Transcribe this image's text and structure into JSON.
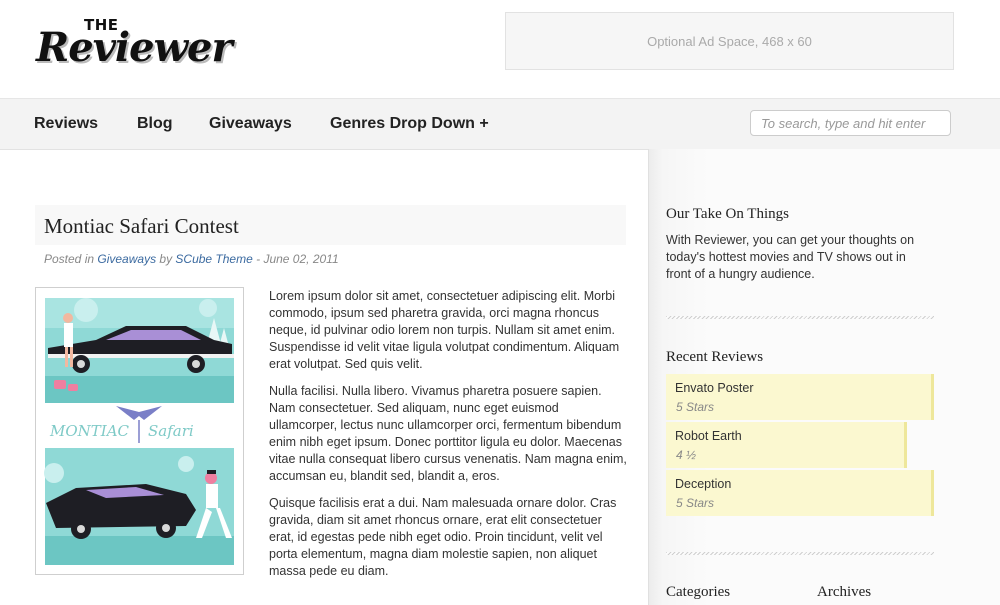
{
  "header": {
    "logo_small": "THE",
    "logo_main": "Reviewer",
    "ad_text": "Optional Ad Space, 468 x 60"
  },
  "nav": {
    "items": [
      {
        "label": "Reviews"
      },
      {
        "label": "Blog"
      },
      {
        "label": "Giveaways"
      },
      {
        "label": "Genres Drop Down +"
      }
    ],
    "search_placeholder": "To search, type and hit enter"
  },
  "post": {
    "title": "Montiac Safari Contest",
    "meta_posted_in": "Posted in ",
    "meta_category": "Giveaways",
    "meta_by": " by ",
    "meta_author": "SCube Theme",
    "meta_date": " - June 02, 2011",
    "image_alt": "Montiac Safari poster",
    "image_text_left": "MONTIAC",
    "image_text_right": "Safari",
    "paragraphs": [
      "Lorem ipsum dolor sit amet, consectetuer adipiscing elit. Morbi commodo, ipsum sed pharetra gravida, orci magna rhoncus neque, id pulvinar odio lorem non turpis. Nullam sit amet enim. Suspendisse id velit vitae ligula volutpat condimentum. Aliquam erat volutpat. Sed quis velit.",
      "Nulla facilisi. Nulla libero. Vivamus pharetra posuere sapien. Nam consectetuer. Sed aliquam, nunc eget euismod ullamcorper, lectus nunc ullamcorper orci, fermentum bibendum enim nibh eget ipsum. Donec porttitor ligula eu dolor. Maecenas vitae nulla consequat libero cursus venenatis. Nam magna enim, accumsan eu, blandit sed, blandit a, eros.",
      "Quisque facilisis erat a dui. Nam malesuada ornare dolor. Cras gravida, diam sit amet rhoncus ornare, erat elit consectetuer erat, id egestas pede nibh eget odio. Proin tincidunt, velit vel porta elementum, magna diam molestie sapien, non aliquet massa pede eu diam."
    ]
  },
  "sidebar": {
    "about_title": "Our Take On Things",
    "about_text": "With Reviewer, you can get your thoughts on today's hottest movies and TV shows out in front of a hungry audience.",
    "recent_title": "Recent Reviews",
    "reviews": [
      {
        "title": "Envato Poster",
        "rating": "5 Stars",
        "fill": 1.0
      },
      {
        "title": "Robot Earth",
        "rating": "4 ½",
        "fill": 0.9
      },
      {
        "title": "Deception",
        "rating": "5 Stars",
        "fill": 1.0
      }
    ],
    "categories_title": "Categories",
    "archives_title": "Archives"
  },
  "colors": {
    "accent_link": "#3b6aa0",
    "review_bg": "#fbf8d0",
    "review_bar": "#eee79b",
    "poster_teal": "#7fd3d0"
  }
}
